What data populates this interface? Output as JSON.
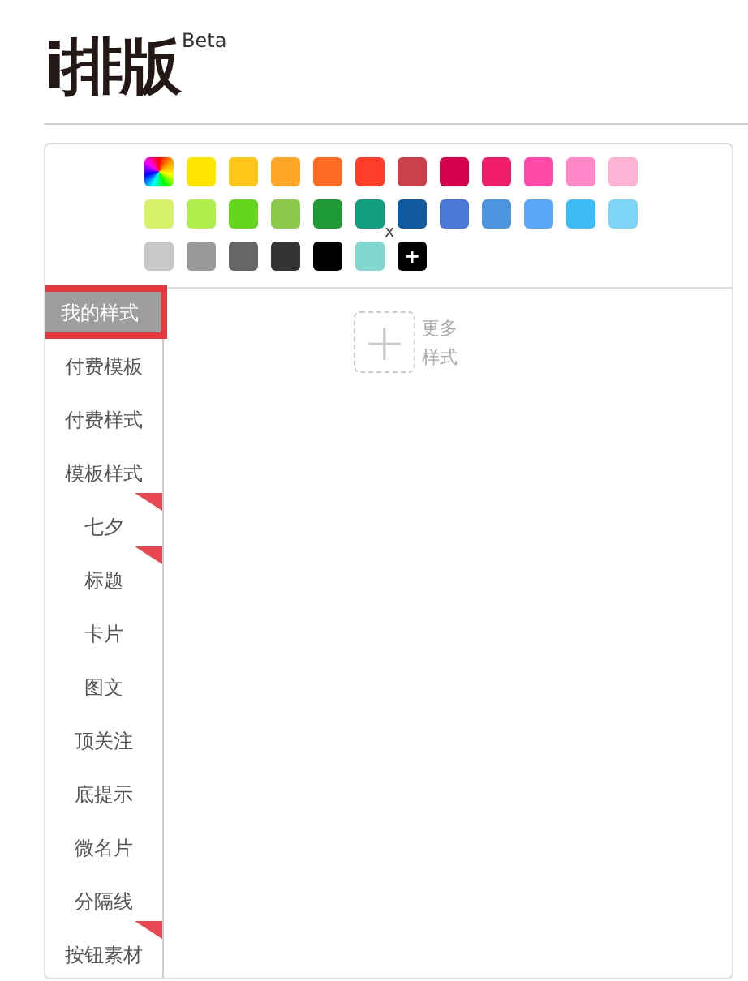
{
  "logo": {
    "title": "i排版",
    "badge": "Beta"
  },
  "palette": {
    "swatches": [
      {
        "kind": "rainbow"
      },
      {
        "kind": "color",
        "color": "#ffe600"
      },
      {
        "kind": "color",
        "color": "#ffc61a"
      },
      {
        "kind": "color",
        "color": "#ffa726"
      },
      {
        "kind": "color",
        "color": "#ff6a22"
      },
      {
        "kind": "color",
        "color": "#ff3d2a"
      },
      {
        "kind": "color",
        "color": "#c9424a"
      },
      {
        "kind": "color",
        "color": "#d4004c"
      },
      {
        "kind": "color",
        "color": "#f01e6a"
      },
      {
        "kind": "color",
        "color": "#ff4aa8"
      },
      {
        "kind": "color",
        "color": "#ff88c8"
      },
      {
        "kind": "color",
        "color": "#ffb3d4"
      },
      {
        "kind": "color",
        "color": "#d8f26c"
      },
      {
        "kind": "color",
        "color": "#b0ee4e"
      },
      {
        "kind": "color",
        "color": "#66d51e"
      },
      {
        "kind": "color",
        "color": "#8cc84b"
      },
      {
        "kind": "color",
        "color": "#1e9a34"
      },
      {
        "kind": "color",
        "color": "#13a07e"
      },
      {
        "kind": "color",
        "color": "#0e5a9c"
      },
      {
        "kind": "color",
        "color": "#4a78d8"
      },
      {
        "kind": "color",
        "color": "#4a94e0"
      },
      {
        "kind": "color",
        "color": "#5aa8f5"
      },
      {
        "kind": "color",
        "color": "#3bbcf5"
      },
      {
        "kind": "color",
        "color": "#7ed4f5"
      },
      {
        "kind": "color",
        "color": "#c8c8c8"
      },
      {
        "kind": "color",
        "color": "#999999"
      },
      {
        "kind": "color",
        "color": "#666666"
      },
      {
        "kind": "color",
        "color": "#333333"
      },
      {
        "kind": "color",
        "color": "#000000"
      },
      {
        "kind": "custom",
        "color": "#80d8d0",
        "remove_label": "x"
      },
      {
        "kind": "add",
        "label": "+"
      }
    ]
  },
  "sidebar": {
    "items": [
      {
        "label": "我的样式",
        "selected": true,
        "flagged": false
      },
      {
        "label": "付费模板",
        "selected": false,
        "flagged": false
      },
      {
        "label": "付费样式",
        "selected": false,
        "flagged": false
      },
      {
        "label": "模板样式",
        "selected": false,
        "flagged": false
      },
      {
        "label": "七夕",
        "selected": false,
        "flagged": true
      },
      {
        "label": "标题",
        "selected": false,
        "flagged": true
      },
      {
        "label": "卡片",
        "selected": false,
        "flagged": false
      },
      {
        "label": "图文",
        "selected": false,
        "flagged": false
      },
      {
        "label": "顶关注",
        "selected": false,
        "flagged": false
      },
      {
        "label": "底提示",
        "selected": false,
        "flagged": false
      },
      {
        "label": "微名片",
        "selected": false,
        "flagged": false
      },
      {
        "label": "分隔线",
        "selected": false,
        "flagged": false
      },
      {
        "label": "按钮素材",
        "selected": false,
        "flagged": true
      }
    ]
  },
  "content": {
    "more_button": {
      "icon": "+",
      "label": "更多样式"
    }
  }
}
